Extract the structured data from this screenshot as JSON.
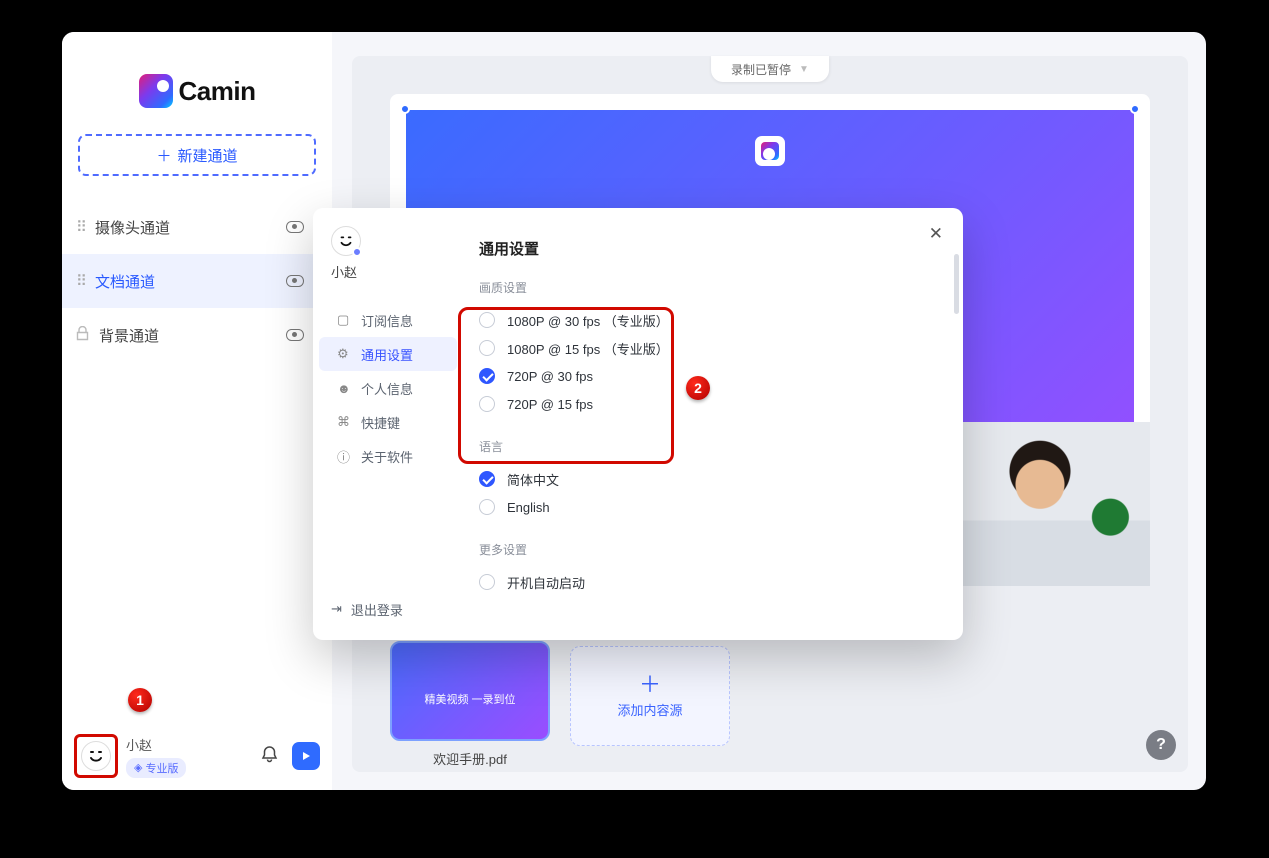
{
  "app": {
    "name": "Camin"
  },
  "window": {
    "record_status": "录制已暂停"
  },
  "sidebar": {
    "new_channel_label": "新建通道",
    "channels": [
      {
        "label": "摄像头通道",
        "type": "draggable",
        "active": false
      },
      {
        "label": "文档通道",
        "type": "draggable",
        "active": true
      },
      {
        "label": "背景通道",
        "type": "locked",
        "active": false
      }
    ],
    "user": {
      "name": "小赵",
      "badge_label": "专业版"
    }
  },
  "main": {
    "doc_tile": {
      "line1": "精美视频  一录到位",
      "caption": "欢迎手册.pdf"
    },
    "add_tile_label": "添加内容源"
  },
  "settings": {
    "user_name": "小赵",
    "nav": {
      "subscription": "订阅信息",
      "general": "通用设置",
      "profile": "个人信息",
      "shortcuts": "快捷键",
      "about": "关于软件",
      "logout": "退出登录"
    },
    "title": "通用设置",
    "quality": {
      "header": "画质设置",
      "options": [
        {
          "label": "1080P @ 30 fps （专业版）",
          "selected": false
        },
        {
          "label": "1080P @ 15 fps （专业版）",
          "selected": false
        },
        {
          "label": "720P @ 30 fps",
          "selected": true
        },
        {
          "label": "720P @ 15 fps",
          "selected": false
        }
      ]
    },
    "language": {
      "header": "语言",
      "options": [
        {
          "label": "简体中文",
          "selected": true
        },
        {
          "label": "English",
          "selected": false
        }
      ]
    },
    "more": {
      "header": "更多设置",
      "autostart_label": "开机自动启动",
      "autostart_selected": false
    }
  },
  "annotations": {
    "one": "1",
    "two": "2"
  }
}
